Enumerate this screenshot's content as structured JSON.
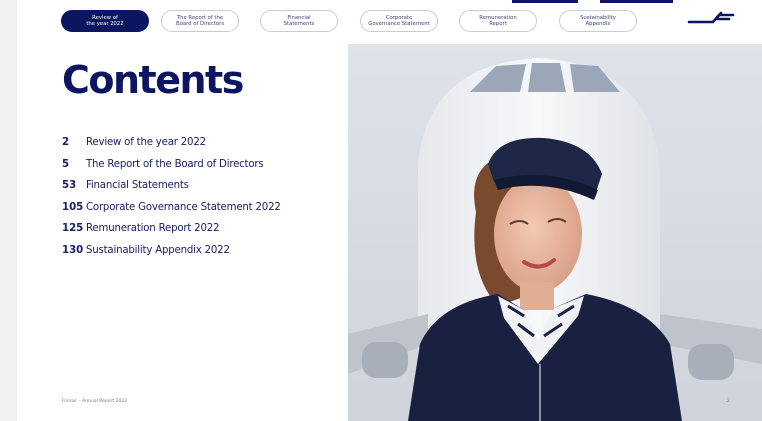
{
  "nav": {
    "tabs": [
      {
        "label": "Review of\nthe year 2022",
        "active": true
      },
      {
        "label": "The Report of the\nBoard of Directors",
        "active": false
      },
      {
        "label": "Financial\nStatements",
        "active": false
      },
      {
        "label": "Corporate\nGovernance Statement",
        "active": false
      },
      {
        "label": "Remuneration\nReport",
        "active": false
      },
      {
        "label": "Sustainability\nAppendix",
        "active": false
      }
    ]
  },
  "page": {
    "title": "Contents",
    "toc": [
      {
        "page": "2",
        "label": "Review of the year 2022"
      },
      {
        "page": "5",
        "label": "The Report of the Board of Directors"
      },
      {
        "page": "53",
        "label": "Financial Statements"
      },
      {
        "page": "105",
        "label": "Corporate Governance Statement 2022"
      },
      {
        "page": "125",
        "label": "Remuneration Report 2022"
      },
      {
        "page": "130",
        "label": "Sustainability Appendix 2022"
      }
    ]
  },
  "footer": {
    "left": "Finnair – Annual Report 2022",
    "page_number": "2"
  },
  "colors": {
    "brand_navy": "#0b1560",
    "tab_border": "#c9ccd8"
  },
  "icons": {
    "logo": "finnair-logo-icon"
  }
}
